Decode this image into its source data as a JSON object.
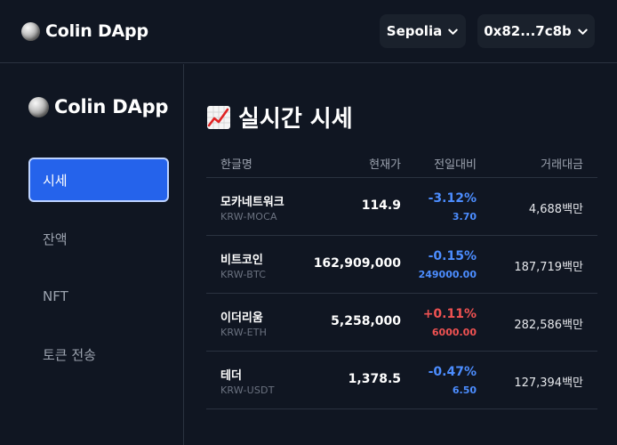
{
  "header": {
    "brand": "Colin DApp",
    "network": "Sepolia",
    "account": "0x82...7c8b"
  },
  "sidebar": {
    "brand": "Colin DApp",
    "items": [
      {
        "label": "시세",
        "active": true
      },
      {
        "label": "잔액",
        "active": false
      },
      {
        "label": "NFT",
        "active": false
      },
      {
        "label": "토큰 전송",
        "active": false
      }
    ]
  },
  "main": {
    "title": "실시간 시세",
    "table": {
      "headers": {
        "name": "한글명",
        "price": "현재가",
        "change": "전일대비",
        "volume": "거래대금"
      },
      "rows": [
        {
          "name": "모카네트워크",
          "code": "KRW-MOCA",
          "price": "114.9",
          "rate": "-3.12%",
          "diff": "3.70",
          "volume": "4,688백만",
          "direction": "down"
        },
        {
          "name": "비트코인",
          "code": "KRW-BTC",
          "price": "162,909,000",
          "rate": "-0.15%",
          "diff": "249000.00",
          "volume": "187,719백만",
          "direction": "down"
        },
        {
          "name": "이더리움",
          "code": "KRW-ETH",
          "price": "5,258,000",
          "rate": "+0.11%",
          "diff": "6000.00",
          "volume": "282,586백만",
          "direction": "up"
        },
        {
          "name": "테더",
          "code": "KRW-USDT",
          "price": "1,378.5",
          "rate": "-0.47%",
          "diff": "6.50",
          "volume": "127,394백만",
          "direction": "down"
        }
      ]
    }
  },
  "colors": {
    "background": "#101622",
    "accent": "#2563eb",
    "down": "#4c8dff",
    "up": "#f05252"
  }
}
